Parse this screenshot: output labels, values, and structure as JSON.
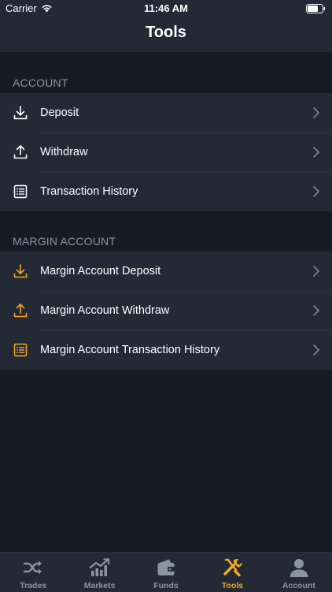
{
  "status_bar": {
    "carrier": "Carrier",
    "time": "11:46 AM"
  },
  "nav": {
    "title": "Tools"
  },
  "sections": [
    {
      "header": "ACCOUNT",
      "items": [
        {
          "label": "Deposit",
          "icon": "download-icon"
        },
        {
          "label": "Withdraw",
          "icon": "upload-icon"
        },
        {
          "label": "Transaction History",
          "icon": "list-icon"
        }
      ]
    },
    {
      "header": "MARGIN ACCOUNT",
      "items": [
        {
          "label": "Margin Account Deposit",
          "icon": "download-icon"
        },
        {
          "label": "Margin Account Withdraw",
          "icon": "upload-icon"
        },
        {
          "label": "Margin Account Transaction History",
          "icon": "list-icon"
        }
      ]
    }
  ],
  "tabbar": {
    "active": "Tools",
    "tabs": [
      {
        "label": "Trades",
        "icon": "shuffle-icon"
      },
      {
        "label": "Markets",
        "icon": "chart-icon"
      },
      {
        "label": "Funds",
        "icon": "wallet-icon"
      },
      {
        "label": "Tools",
        "icon": "tools-icon"
      },
      {
        "label": "Account",
        "icon": "person-icon"
      }
    ]
  },
  "colors": {
    "background": "#161b24",
    "surface": "#232a36",
    "accent": "#f5a623",
    "muted": "#8d94a1"
  }
}
